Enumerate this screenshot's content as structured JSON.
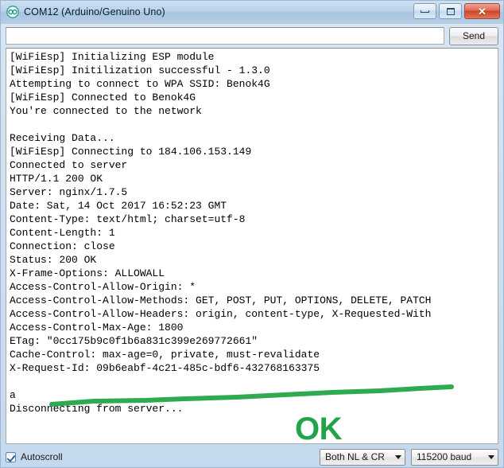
{
  "window": {
    "title": "COM12 (Arduino/Genuino Uno)",
    "app_icon": "arduino-infinity-icon",
    "controls": {
      "minimize": "minimize-icon",
      "maximize": "maximize-icon",
      "close": "✕"
    }
  },
  "send_row": {
    "input_value": "",
    "input_placeholder": "",
    "send_label": "Send"
  },
  "console": {
    "lines": [
      "[WiFiEsp] Initializing ESP module",
      "[WiFiEsp] Initilization successful - 1.3.0",
      "Attempting to connect to WPA SSID: Benok4G",
      "[WiFiEsp] Connected to Benok4G",
      "You're connected to the network",
      "",
      "Receiving Data...",
      "[WiFiEsp] Connecting to 184.106.153.149",
      "Connected to server",
      "HTTP/1.1 200 OK",
      "Server: nginx/1.7.5",
      "Date: Sat, 14 Oct 2017 16:52:23 GMT",
      "Content-Type: text/html; charset=utf-8",
      "Content-Length: 1",
      "Connection: close",
      "Status: 200 OK",
      "X-Frame-Options: ALLOWALL",
      "Access-Control-Allow-Origin: *",
      "Access-Control-Allow-Methods: GET, POST, PUT, OPTIONS, DELETE, PATCH",
      "Access-Control-Allow-Headers: origin, content-type, X-Requested-With",
      "Access-Control-Max-Age: 1800",
      "ETag: \"0cc175b9c0f1b6a831c399e269772661\"",
      "Cache-Control: max-age=0, private, must-revalidate",
      "X-Request-Id: 09b6eabf-4c21-485c-bdf6-432768163375",
      "",
      "a",
      "Disconnecting from server..."
    ]
  },
  "annotations": {
    "ok_text": "OK",
    "ok_color": "#22a34a",
    "underline_color": "#2faa4f",
    "underline_name": "hand-drawn-underline"
  },
  "bottom_bar": {
    "autoscroll_label": "Autoscroll",
    "autoscroll_checked": true,
    "line_ending": "Both NL & CR",
    "baud_rate": "115200 baud"
  },
  "colors": {
    "title_bar": "#b3cde4",
    "window_body": "#cfe0f1",
    "console_bg": "#ffffff",
    "close_button": "#cc4526",
    "accent_green": "#22a34a"
  }
}
